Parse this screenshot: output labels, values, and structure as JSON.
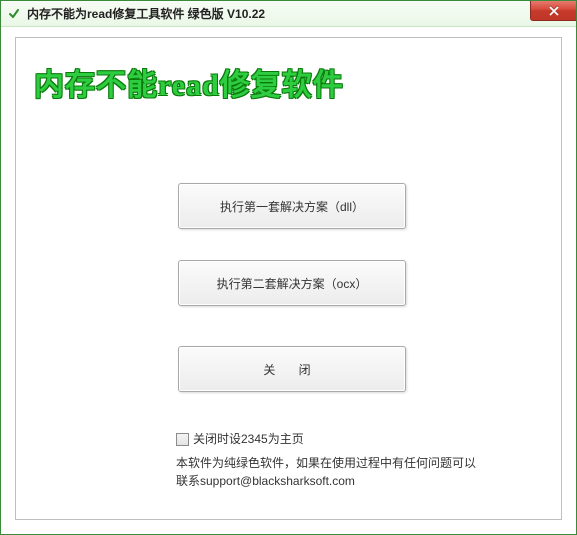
{
  "titlebar": {
    "title": "内存不能为read修复工具软件 绿色版 V10.22"
  },
  "heading": "内存不能read修复软件",
  "buttons": {
    "plan1": "执行第一套解决方案（dll）",
    "plan2": "执行第二套解决方案（ocx）",
    "close": "关 闭"
  },
  "footer": {
    "checkbox_label": "关闭时设2345为主页",
    "info_line1": "本软件为纯绿色软件，如果在使用过程中有任何问题可以",
    "info_line2": "联系support@blacksharksoft.com"
  }
}
